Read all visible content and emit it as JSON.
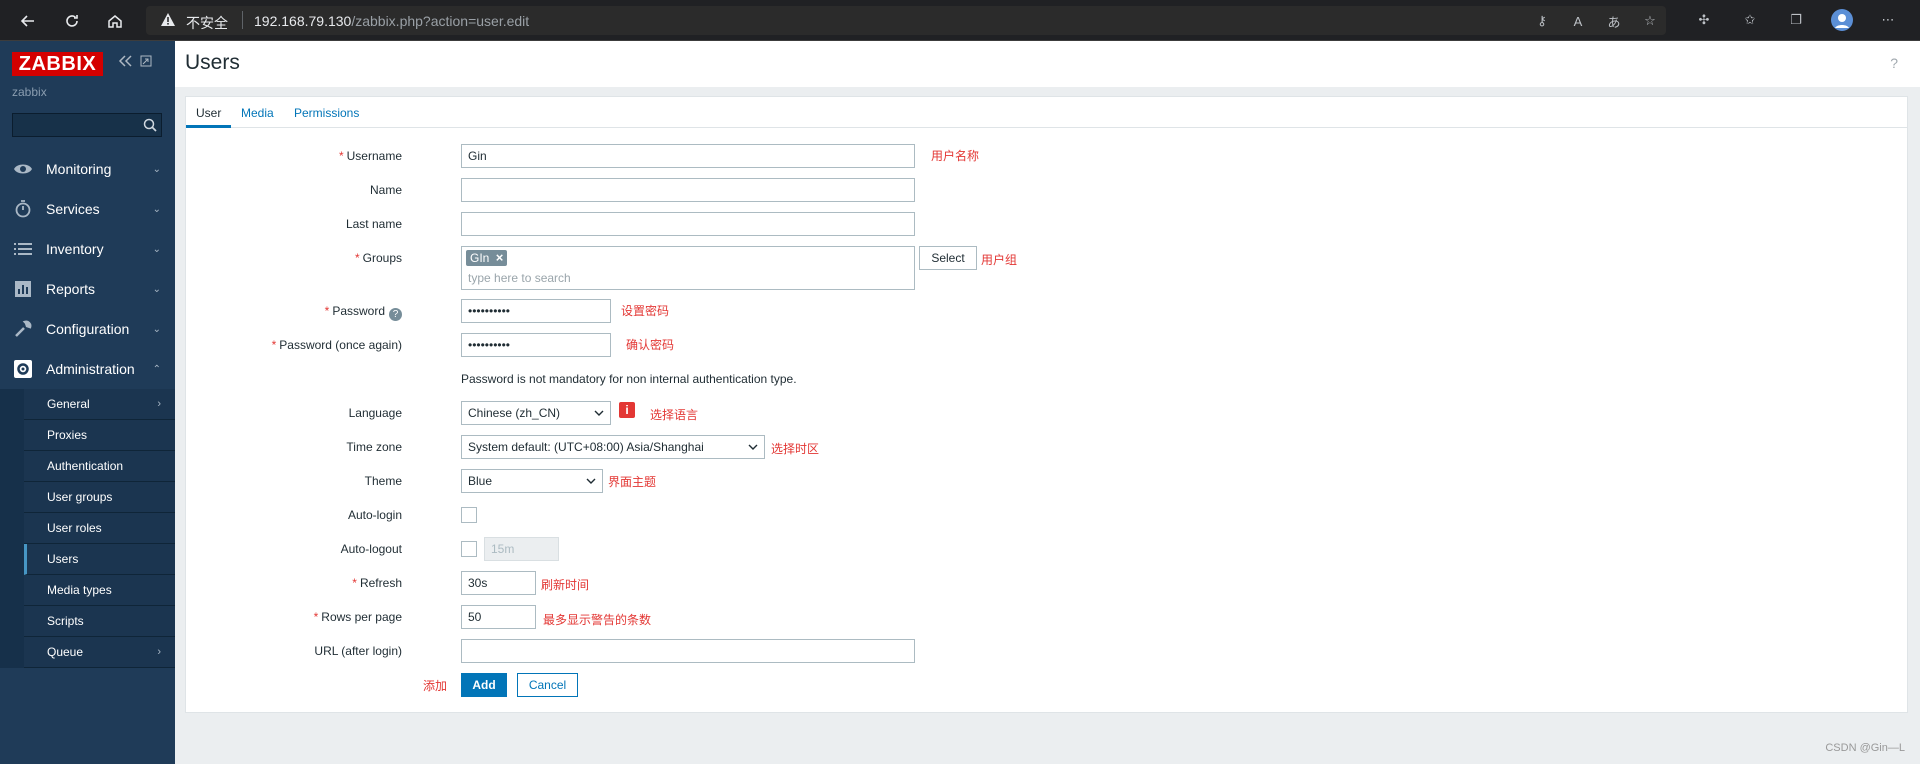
{
  "browser": {
    "insecure_label": "不安全",
    "url_host": "192.168.79.130",
    "url_path": "/zabbix.php?action=user.edit"
  },
  "sidebar": {
    "logo": "ZABBIX",
    "server_name": "zabbix",
    "search_placeholder": "",
    "menu": [
      {
        "label": "Monitoring",
        "icon": "eye-icon"
      },
      {
        "label": "Services",
        "icon": "stopwatch-icon"
      },
      {
        "label": "Inventory",
        "icon": "list-icon"
      },
      {
        "label": "Reports",
        "icon": "bar-chart-icon"
      },
      {
        "label": "Configuration",
        "icon": "wrench-icon"
      },
      {
        "label": "Administration",
        "icon": "gear-icon"
      }
    ],
    "submenu": [
      {
        "label": "General"
      },
      {
        "label": "Proxies"
      },
      {
        "label": "Authentication"
      },
      {
        "label": "User groups"
      },
      {
        "label": "User roles"
      },
      {
        "label": "Users"
      },
      {
        "label": "Media types"
      },
      {
        "label": "Scripts"
      },
      {
        "label": "Queue"
      }
    ]
  },
  "header": {
    "title": "Users",
    "help": "?"
  },
  "tabs": [
    {
      "label": "User"
    },
    {
      "label": "Media"
    },
    {
      "label": "Permissions"
    }
  ],
  "form": {
    "username_label": "Username",
    "username_value": "Gin",
    "name_label": "Name",
    "name_value": "",
    "lastname_label": "Last name",
    "lastname_value": "",
    "groups_label": "Groups",
    "groups_tag": "GIn",
    "groups_placeholder": "type here to search",
    "select_button": "Select",
    "password_label": "Password",
    "password_value": "••••••••••",
    "password_again_label": "Password (once again)",
    "password_again_value": "••••••••••",
    "password_note": "Password is not mandatory for non internal authentication type.",
    "language_label": "Language",
    "language_value": "Chinese (zh_CN)",
    "timezone_label": "Time zone",
    "timezone_value": "System default: (UTC+08:00) Asia/Shanghai",
    "theme_label": "Theme",
    "theme_value": "Blue",
    "autologin_label": "Auto-login",
    "autologout_label": "Auto-logout",
    "autologout_value": "15m",
    "refresh_label": "Refresh",
    "refresh_value": "30s",
    "rows_label": "Rows per page",
    "rows_value": "50",
    "url_label": "URL (after login)",
    "url_value": "",
    "add_button": "Add",
    "cancel_button": "Cancel"
  },
  "annotations": {
    "username": "用户名称",
    "groups": "用户组",
    "password": "设置密码",
    "password_again": "确认密码",
    "language": "选择语言",
    "timezone": "选择时区",
    "theme": "界面主题",
    "refresh": "刷新时间",
    "rows": "最多显示警告的条数",
    "add": "添加"
  },
  "watermark": "CSDN @Gin—L",
  "colors": {
    "sidebar_bg": "#1f3b58",
    "logo_red": "#d40000",
    "accent_blue": "#0275b8",
    "required_red": "#e33734"
  }
}
